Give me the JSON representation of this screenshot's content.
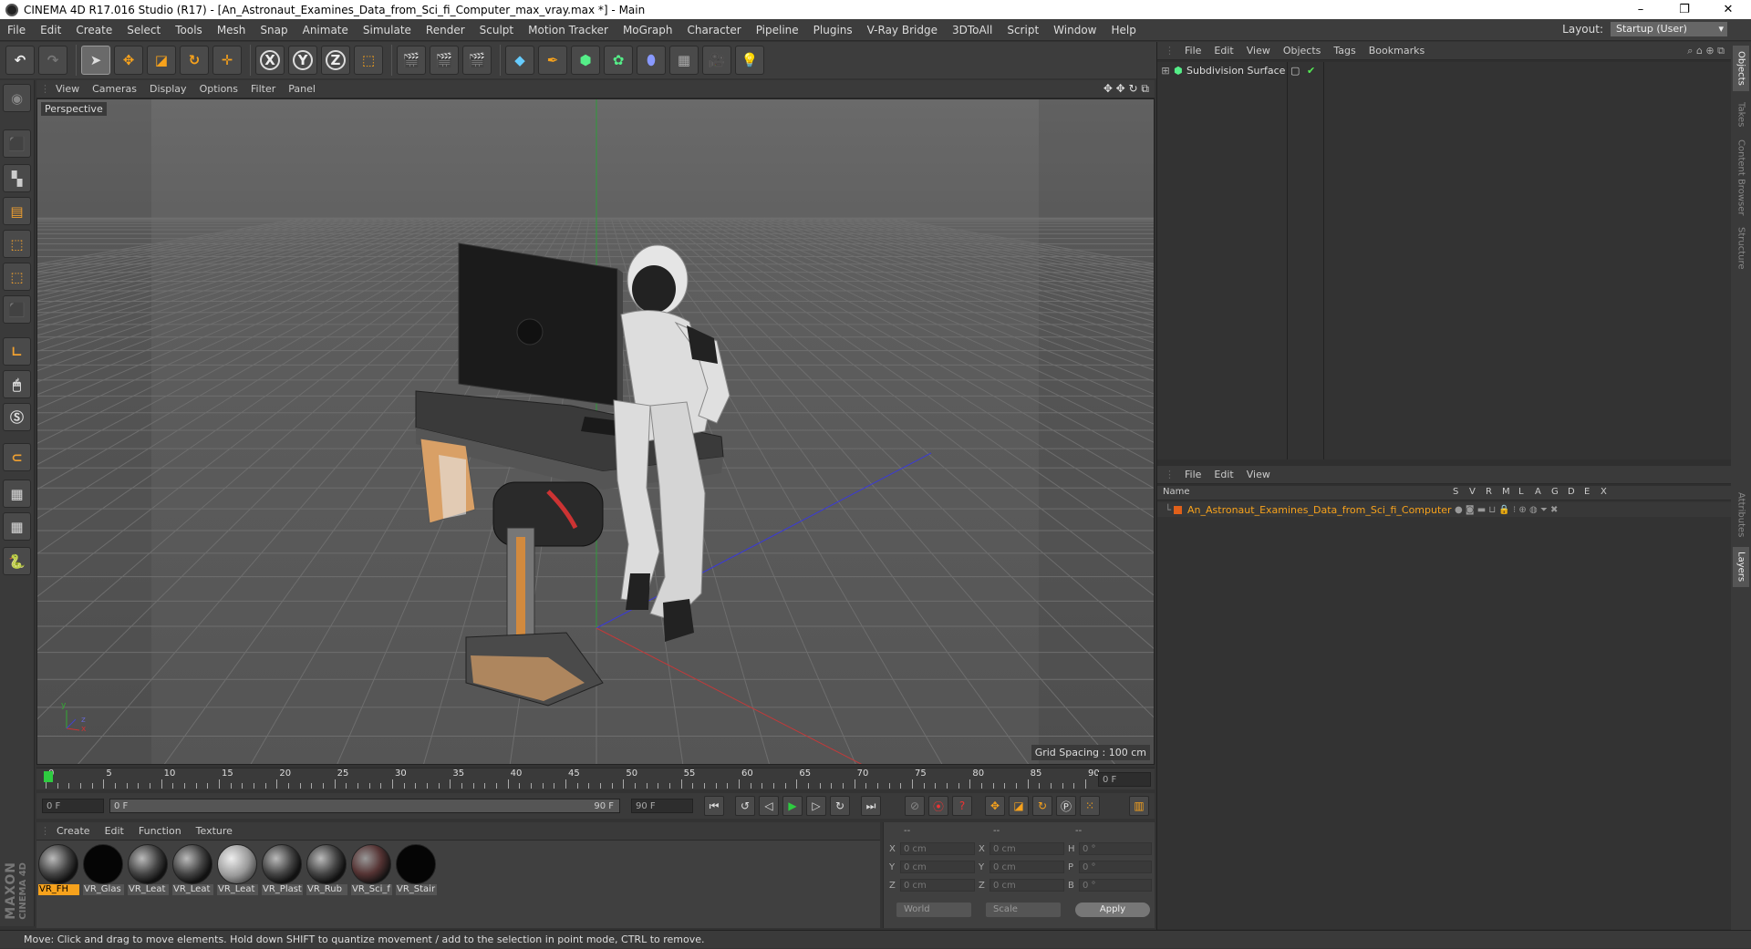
{
  "window": {
    "title": "CINEMA 4D R17.016 Studio (R17) - [An_Astronaut_Examines_Data_from_Sci_fi_Computer_max_vray.max *] - Main",
    "controls": [
      "–",
      "❐",
      "✕"
    ]
  },
  "menubar": {
    "items": [
      "File",
      "Edit",
      "Create",
      "Select",
      "Tools",
      "Mesh",
      "Snap",
      "Animate",
      "Simulate",
      "Render",
      "Sculpt",
      "Motion Tracker",
      "MoGraph",
      "Character",
      "Pipeline",
      "Plugins",
      "V-Ray Bridge",
      "3DToAll",
      "Script",
      "Window",
      "Help"
    ],
    "layout_label": "Layout:",
    "layout_value": "Startup (User)"
  },
  "toolbar": {
    "axis_x": "X",
    "axis_y": "Y",
    "axis_z": "Z"
  },
  "viewport": {
    "menu": [
      "View",
      "Cameras",
      "Display",
      "Options",
      "Filter",
      "Panel"
    ],
    "label": "Perspective",
    "grid_spacing": "Grid Spacing : 100 cm",
    "axis_y": "y",
    "axis_x": "x",
    "axis_z": "z"
  },
  "timeline": {
    "ticks": [
      "0",
      "5",
      "10",
      "15",
      "20",
      "25",
      "30",
      "35",
      "40",
      "45",
      "50",
      "55",
      "60",
      "65",
      "70",
      "75",
      "80",
      "85",
      "90"
    ],
    "current_frame": "0 F"
  },
  "transport": {
    "start_field": "0 F",
    "range_left": "0 F",
    "range_right": "90 F",
    "end_field": "90 F"
  },
  "materials": {
    "menu": [
      "Create",
      "Edit",
      "Function",
      "Texture"
    ],
    "items": [
      "VR_FH",
      "VR_Glas",
      "VR_Leat",
      "VR_Leat",
      "VR_Leat",
      "VR_Plast",
      "VR_Rub",
      "VR_Sci_f",
      "VR_Stair"
    ]
  },
  "coords": {
    "header": [
      "--",
      "--",
      "--"
    ],
    "rows": [
      {
        "k1": "X",
        "v1": "0 cm",
        "k2": "X",
        "v2": "0 cm",
        "k3": "H",
        "v3": "0 °"
      },
      {
        "k1": "Y",
        "v1": "0 cm",
        "k2": "Y",
        "v2": "0 cm",
        "k3": "P",
        "v3": "0 °"
      },
      {
        "k1": "Z",
        "v1": "0 cm",
        "k2": "Z",
        "v2": "0 cm",
        "k3": "B",
        "v3": "0 °"
      }
    ],
    "space": "World",
    "mode": "Scale",
    "apply": "Apply"
  },
  "objects_panel": {
    "menu": [
      "File",
      "Edit",
      "View",
      "Objects",
      "Tags",
      "Bookmarks"
    ],
    "object": "Subdivision Surface"
  },
  "layers_panel": {
    "menu": [
      "File",
      "Edit",
      "View"
    ],
    "header_name": "Name",
    "header_cols": [
      "S",
      "V",
      "R",
      "M",
      "L",
      "A",
      "G",
      "D",
      "E",
      "X"
    ],
    "layer": "An_Astronaut_Examines_Data_from_Sci_fi_Computer"
  },
  "side_tabs": [
    "Objects",
    "Takes",
    "Content Browser",
    "Structure",
    "Attributes",
    "Layers"
  ],
  "statusbar": "Move: Click and drag to move elements. Hold down SHIFT to quantize movement / add to the selection in point mode, CTRL to remove.",
  "logo": [
    "MAXON",
    "CINEMA 4D"
  ],
  "colors": {
    "accent": "#f7a21c",
    "layer_name": "#f7a21c",
    "viewport_bg": "#5a5a5a"
  }
}
